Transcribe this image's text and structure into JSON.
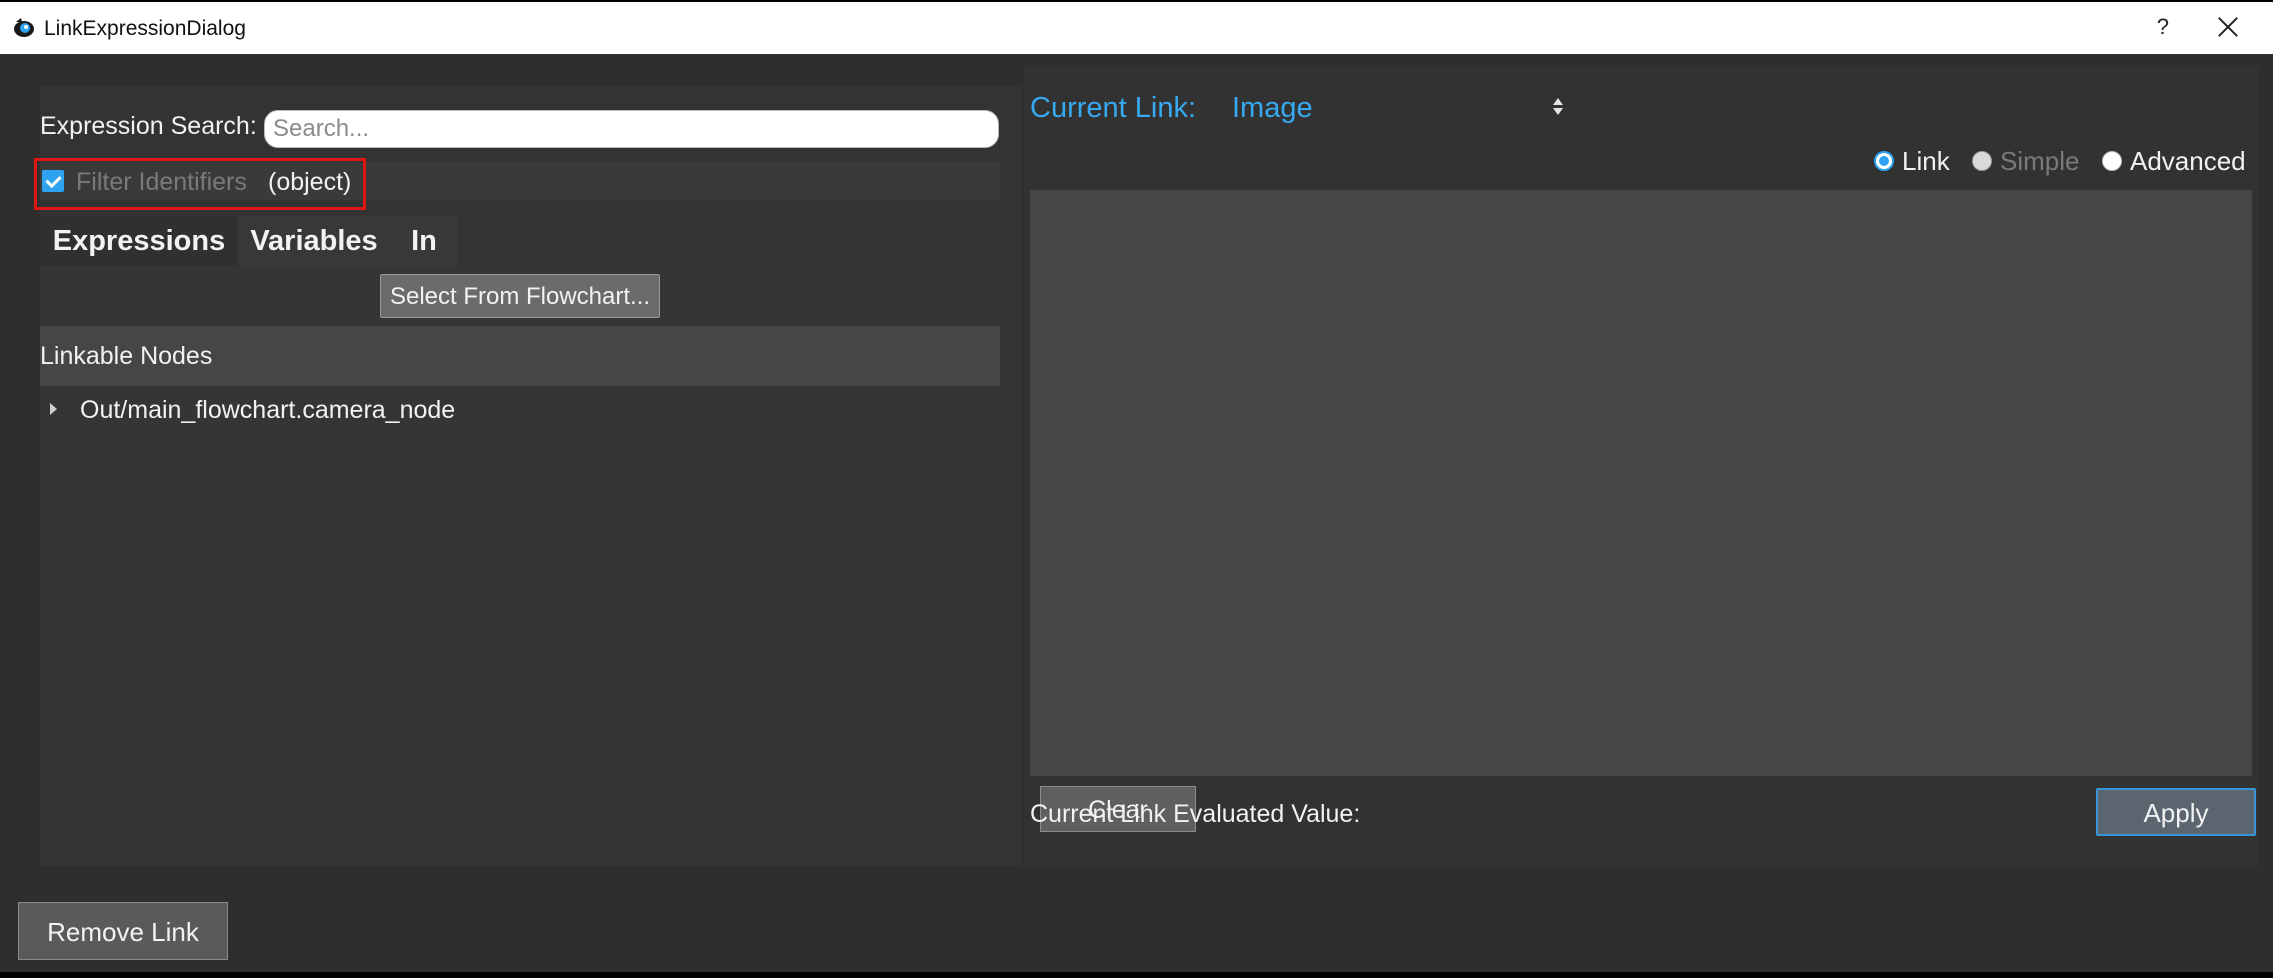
{
  "window": {
    "title": "LinkExpressionDialog",
    "help_label": "?",
    "close_label": ""
  },
  "search": {
    "label": "Expression Search:",
    "placeholder": "Search...",
    "value": ""
  },
  "filter": {
    "checked": true,
    "label": "Filter Identifiers",
    "type_label": "(object)"
  },
  "tabs": [
    {
      "label": "Expressions",
      "active": true
    },
    {
      "label": "Variables",
      "active": false
    },
    {
      "label": "In",
      "active": false
    }
  ],
  "expressions_tab": {
    "select_button_label": "Select From Flowchart...",
    "nodes_header": "Linkable Nodes",
    "nodes": [
      {
        "label": "Out/main_flowchart.camera_node",
        "expanded": false
      }
    ]
  },
  "current_link": {
    "label": "Current Link:",
    "value": "Image"
  },
  "mode": {
    "options": [
      {
        "label": "Link",
        "selected": true,
        "enabled": true
      },
      {
        "label": "Simple",
        "selected": false,
        "enabled": false
      },
      {
        "label": "Advanced",
        "selected": false,
        "enabled": true
      }
    ]
  },
  "editor": {
    "clear_label": "Clear",
    "evaluated_label": "Current Link Evaluated Value:",
    "apply_label": "Apply"
  },
  "footer": {
    "remove_label": "Remove Link"
  },
  "colors": {
    "accent": "#37a9f0",
    "highlight_box": "#e01515",
    "background": "#2e2e2e"
  }
}
